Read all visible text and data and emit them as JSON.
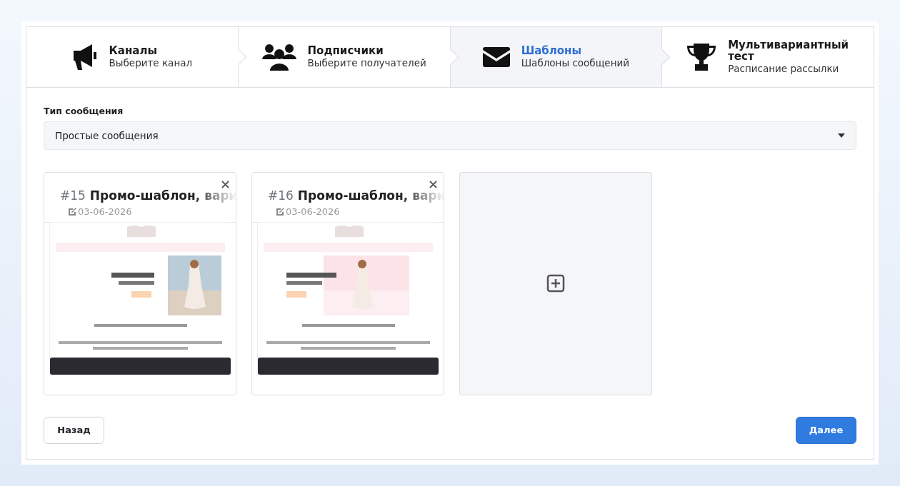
{
  "steps": [
    {
      "kind": "megaphone",
      "title": "Каналы",
      "subtitle": "Выберите канал",
      "selected": false
    },
    {
      "kind": "users",
      "title": "Подписчики",
      "subtitle": "Выберите получателей",
      "selected": false
    },
    {
      "kind": "envelope",
      "title": "Шаблоны",
      "subtitle": "Шаблоны сообщений",
      "selected": true
    },
    {
      "kind": "trophy",
      "title": "Мультивариантный тест",
      "subtitle": "Расписание рассылки",
      "selected": false
    }
  ],
  "message_type": {
    "label": "Тип сообщения",
    "value": "Простые сообщения"
  },
  "templates": [
    {
      "number": "#15",
      "title": "Промо-шаблон, вари",
      "date": "03-06-2026"
    },
    {
      "number": "#16",
      "title": "Промо-шаблон, вари",
      "date": "03-06-2026"
    }
  ],
  "buttons": {
    "back": "Назад",
    "next": "Далее"
  }
}
